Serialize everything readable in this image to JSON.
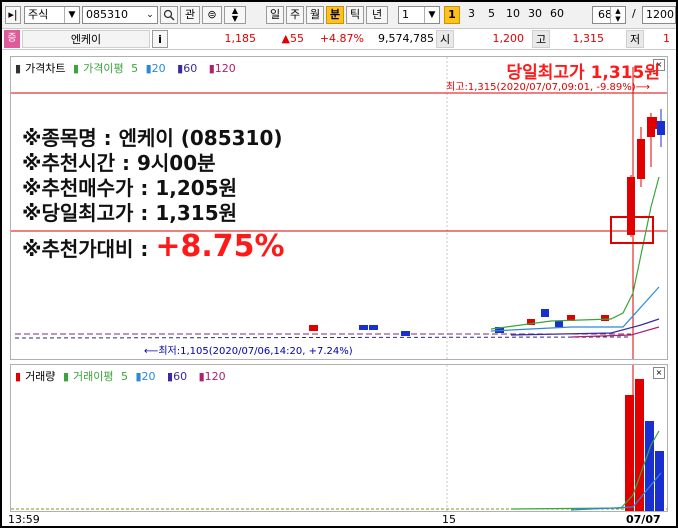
{
  "toolbar": {
    "market_type": "주식",
    "stock_code": "085310",
    "btn_gwan": "관",
    "periods": [
      "일",
      "주",
      "월",
      "분",
      "틱",
      "년"
    ],
    "selected_period": "분",
    "interval_value": "1",
    "quick_minutes": [
      "1",
      "3",
      "5",
      "10",
      "30",
      "60"
    ],
    "selected_minute": "1",
    "zoom": "68",
    "total_bars": "1200"
  },
  "info": {
    "badge": "증",
    "stock_name": "엔케이",
    "info_btn": "i",
    "price": "1,185",
    "change": "▲55",
    "change_pct": "+4.87%",
    "volume": "9,574,785",
    "open_label": "시",
    "open": "1,200",
    "high_label": "고",
    "high": "1,315",
    "low_label": "저",
    "low_value_partial": "1"
  },
  "price_legend": {
    "title": "가격차트",
    "ma_label": "가격이평",
    "ma_values": [
      "5",
      "20",
      "60",
      "120"
    ]
  },
  "volume_legend": {
    "title": "거래량",
    "ma_label": "거래이평",
    "ma_values": [
      "5",
      "20",
      "60",
      "120"
    ]
  },
  "annotations": {
    "day_high_title": "당일최고가 1,315원",
    "high_marker": "최고:1,315(2020/07/07,09:01, -9.89%)⟶",
    "low_marker": "⟵최저:1,105(2020/07/06,14:20, +7.24%)",
    "lines": [
      "※종목명 : 엔케이 (085310)",
      "※추천시간 : 9시00분",
      "※추천매수가 : 1,205원",
      "※당일최고가 : 1,315원"
    ],
    "compare_label": "※추천가대비 : ",
    "compare_value": "+8.75%"
  },
  "xaxis": {
    "start": "13:59",
    "mid": "15",
    "end": "07/07"
  },
  "colors": {
    "up": "#e00000",
    "down": "#1a2fd0",
    "ma5": "#3aa53a",
    "ma20": "#2a8ad8",
    "ma60": "#3a2aa0",
    "ma120": "#b02070"
  },
  "chart_data": {
    "type": "candlestick",
    "price_range": [
      1105,
      1315
    ],
    "recommended_price": 1205,
    "day_high": 1315,
    "day_low": 1105
  }
}
